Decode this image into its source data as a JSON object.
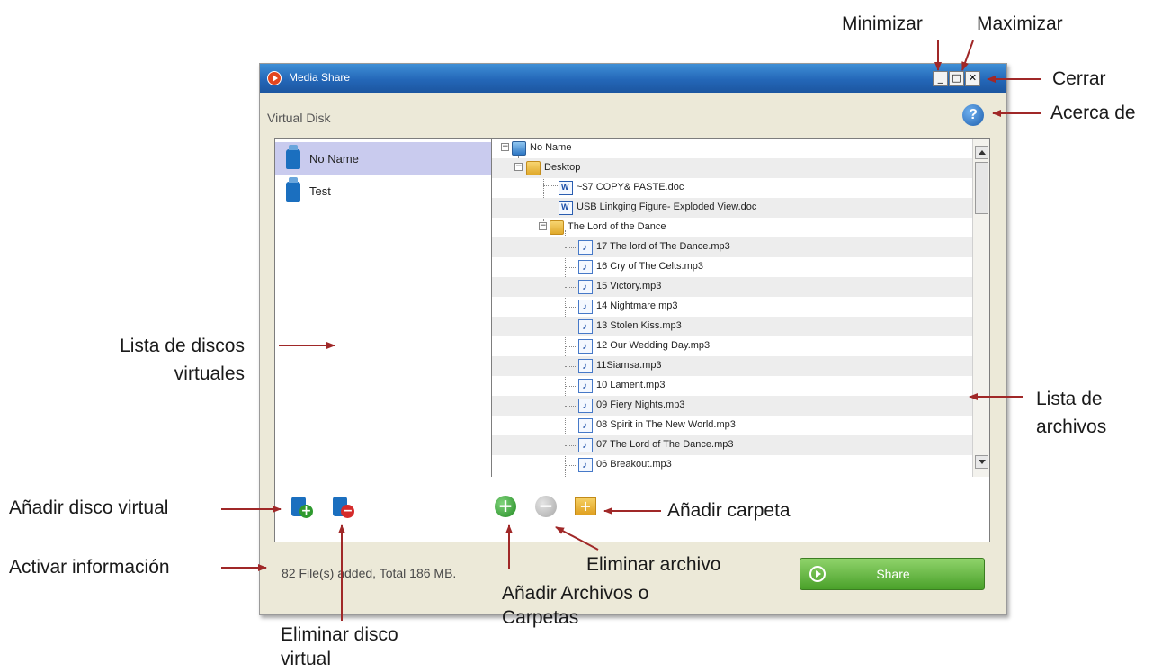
{
  "window": {
    "title": "Media Share",
    "minimize_glyph": "_",
    "maximize_glyph": "□",
    "close_glyph": "✕",
    "virtual_disk_label": "Virtual Disk",
    "help_glyph": "?"
  },
  "disks": [
    {
      "label": "No Name",
      "selected": true
    },
    {
      "label": "Test",
      "selected": false
    }
  ],
  "tree": {
    "root": "No Name",
    "desktop": "Desktop",
    "desktop_files": [
      "~$7 COPY& PASTE.doc",
      "USB Linkging Figure- Exploded View.doc"
    ],
    "folder": "The Lord of the Dance",
    "tracks": [
      "17 The lord of The Dance.mp3",
      "16 Cry of The Celts.mp3",
      "15 Victory.mp3",
      "14 Nightmare.mp3",
      "13 Stolen Kiss.mp3",
      "12 Our Wedding Day.mp3",
      "11Siamsa.mp3",
      "10 Lament.mp3",
      "09 Fiery Nights.mp3",
      "08 Spirit in The New World.mp3",
      "07 The Lord of The Dance.mp3",
      "06 Breakout.mp3"
    ]
  },
  "toolbar": {
    "add_disk_glyph": "+",
    "delete_disk_glyph": "−",
    "add_files_glyph": "+",
    "delete_file_glyph": "−",
    "add_folder_glyph": "+"
  },
  "status_text": "82 File(s) added, Total 186 MB.",
  "share_label": "Share",
  "annotations": {
    "minimize": "Minimizar",
    "maximize": "Maximizar",
    "close": "Cerrar",
    "about": "Acerca de",
    "disk_list_line1": "Lista de discos",
    "disk_list_line2": "virtuales",
    "file_list_line1": "Lista de",
    "file_list_line2": "archivos",
    "add_disk": "Añadir disco virtual",
    "activate_info": "Activar información",
    "add_folder": "Añadir carpeta",
    "delete_file": "Eliminar archivo",
    "add_files_line1": "Añadir Archivos o",
    "add_files_line2": "Carpetas",
    "delete_disk_line1": "Eliminar disco",
    "delete_disk_line2": "virtual"
  },
  "colors": {
    "titlebar": "#2467b8",
    "selection": "#c9cbee",
    "share_button": "#4aa12a",
    "window_bg": "#ece9d8"
  }
}
